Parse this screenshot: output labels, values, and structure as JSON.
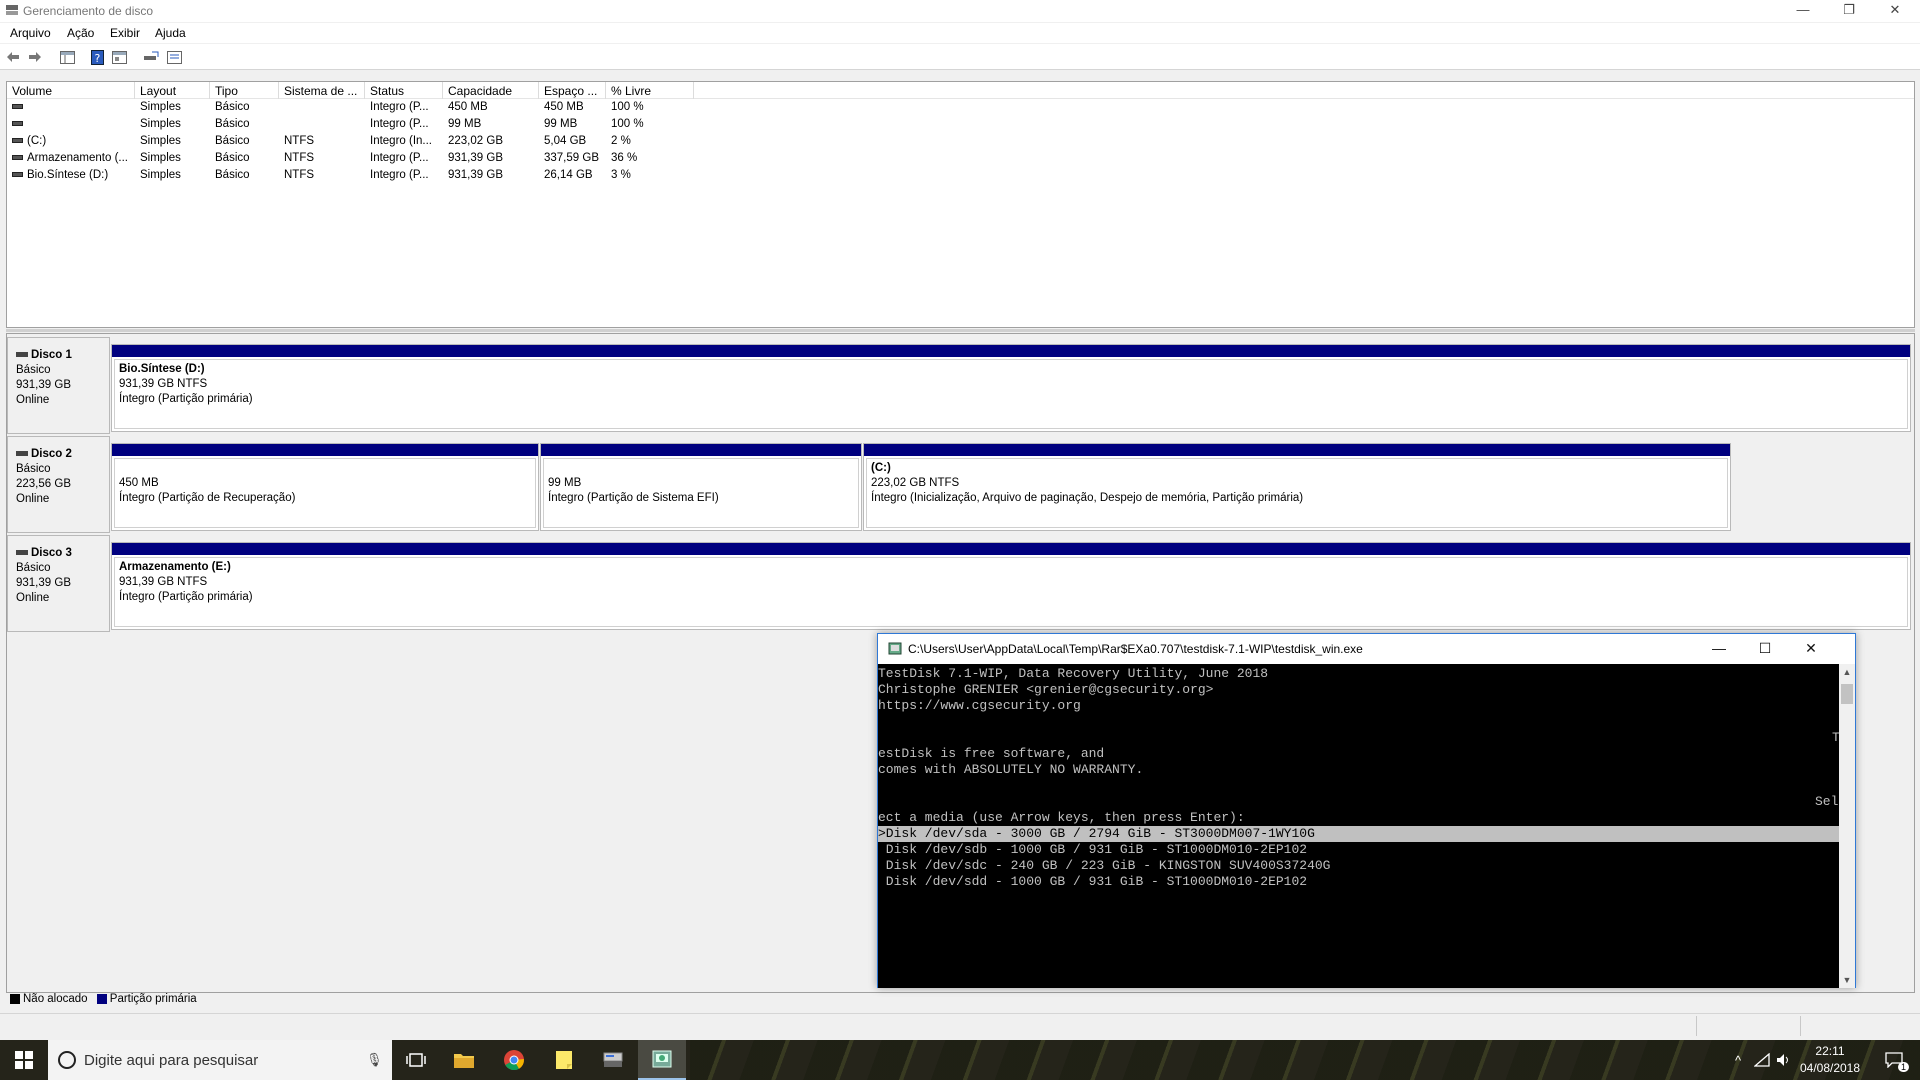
{
  "window": {
    "title": "Gerenciamento de disco",
    "controls": {
      "minimize": "—",
      "restore": "❐",
      "close": "✕"
    }
  },
  "menu": [
    "Arquivo",
    "Ação",
    "Exibir",
    "Ajuda"
  ],
  "toolbar_icons": [
    "back-icon",
    "forward-icon",
    "console-tree-icon",
    "help-icon",
    "properties-icon",
    "rescan-icon",
    "view-icon"
  ],
  "volume_list": {
    "columns": [
      "Volume",
      "Layout",
      "Tipo",
      "Sistema de ...",
      "Status",
      "Capacidade",
      "Espaço ...",
      "% Livre"
    ],
    "rows": [
      [
        "",
        "Simples",
        "Básico",
        "",
        "Íntegro (P...",
        "450 MB",
        "450 MB",
        "100 %"
      ],
      [
        "",
        "Simples",
        "Básico",
        "",
        "Íntegro (P...",
        "99 MB",
        "99 MB",
        "100 %"
      ],
      [
        "(C:)",
        "Simples",
        "Básico",
        "NTFS",
        "Íntegro (In...",
        "223,02 GB",
        "5,04 GB",
        "2 %"
      ],
      [
        "Armazenamento (...",
        "Simples",
        "Básico",
        "NTFS",
        "Íntegro (P...",
        "931,39 GB",
        "337,59 GB",
        "36 %"
      ],
      [
        "Bio.Síntese (D:)",
        "Simples",
        "Básico",
        "NTFS",
        "Íntegro (P...",
        "931,39 GB",
        "26,14 GB",
        "3 %"
      ]
    ]
  },
  "disks": [
    {
      "name": "Disco 1",
      "type": "Básico",
      "size": "931,39 GB",
      "state": "Online",
      "partitions": [
        {
          "title": "Bio.Síntese  (D:)",
          "size": "931,39 GB NTFS",
          "status": "Íntegro (Partição primária)"
        }
      ]
    },
    {
      "name": "Disco 2",
      "type": "Básico",
      "size": "223,56 GB",
      "state": "Online",
      "partitions": [
        {
          "title": "",
          "size": "450 MB",
          "status": "Íntegro (Partição de Recuperação)"
        },
        {
          "title": "",
          "size": "99 MB",
          "status": "Íntegro (Partição de Sistema EFI)"
        },
        {
          "title": "(C:)",
          "size": "223,02 GB NTFS",
          "status": "Íntegro (Inicialização, Arquivo de paginação, Despejo de memória, Partição primária)"
        }
      ]
    },
    {
      "name": "Disco 3",
      "type": "Básico",
      "size": "931,39 GB",
      "state": "Online",
      "partitions": [
        {
          "title": "Armazenamento  (E:)",
          "size": "931,39 GB NTFS",
          "status": "Íntegro (Partição primária)"
        }
      ]
    }
  ],
  "legend": {
    "unallocated": "Não alocado",
    "primary": "Partição primária",
    "unallocated_color": "#000000",
    "primary_color": "#00007f"
  },
  "console": {
    "title": "C:\\Users\\User\\AppData\\Local\\Temp\\Rar$EXa0.707\\testdisk-7.1-WIP\\testdisk_win.exe",
    "controls": {
      "minimize": "—",
      "maximize": "☐",
      "close": "✕"
    },
    "lines": [
      "TestDisk 7.1-WIP, Data Recovery Utility, June 2018",
      "Christophe GRENIER <grenier@cgsecurity.org>",
      "https://www.cgsecurity.org",
      "",
      "",
      "estDisk is free software, and",
      "comes with ABSOLUTELY NO WARRANTY.",
      "",
      "",
      "ect a media (use Arrow keys, then press Enter):",
      ">Disk /dev/sda - 3000 GB / 2794 GiB - ST3000DM007-1WY10G",
      " Disk /dev/sdb - 1000 GB / 931 GiB - ST1000DM010-2EP102",
      " Disk /dev/sdc - 240 GB / 223 GiB - KINGSTON SUV400S37240G",
      " Disk /dev/sdd - 1000 GB / 931 GiB - ST1000DM010-2EP102"
    ],
    "wrap_fragments": [
      "T",
      "Sel"
    ],
    "selected_line": 10
  },
  "taskbar": {
    "search_placeholder": "Digite aqui para pesquisar",
    "apps": [
      "task-view-icon",
      "file-explorer-icon",
      "chrome-icon",
      "sticky-notes-icon",
      "disk-management-icon",
      "testdisk-icon"
    ],
    "time": "22:11",
    "date": "04/08/2018",
    "notification_count": "1"
  }
}
